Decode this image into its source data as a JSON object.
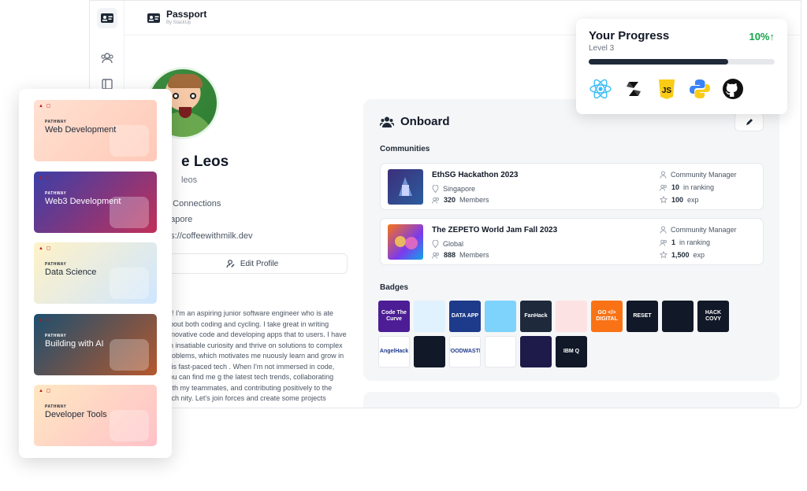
{
  "app": {
    "title": "Passport",
    "subtitle": "By StackUp"
  },
  "profile": {
    "name": "e Leos",
    "handle": "leos",
    "connections": "0 Connections",
    "location": "gapore",
    "website": "ps://coffeewithmilk.dev",
    "edit_label": "Edit Profile",
    "about_title": ":",
    "about_text": "re! I'm an aspiring junior software engineer who is ate about both coding and cycling. I take great in writing innovative code and developing apps that to users. I have an insatiable curiosity and thrive on solutions to complex problems, which motivates me nuously learn and grow in this fast-paced tech . When I'm not immersed in code, you can find me g the latest tech trends, collaborating with my teammates, and contributing positively to the tech nity. Let's join forces and create some projects"
  },
  "onboard": {
    "title": "Onboard",
    "communities_label": "Communities",
    "badges_label": "Badges",
    "communities": [
      {
        "name": "EthSG Hackathon 2023",
        "location": "Singapore",
        "members": "320",
        "members_label": "Members",
        "role": "Community Manager",
        "ranking": "10",
        "ranking_label": "in ranking",
        "exp": "100",
        "exp_label": "exp"
      },
      {
        "name": "The ZEPETO World Jam Fall 2023",
        "location": "Global",
        "members": "888",
        "members_label": "Members",
        "role": "Community Manager",
        "ranking": "1",
        "ranking_label": "in ranking",
        "exp": "1,500",
        "exp_label": "exp"
      }
    ],
    "badges": [
      {
        "text": "Code The Curve",
        "color": "#4c1d95"
      },
      {
        "text": "",
        "color": "#e0f2fe"
      },
      {
        "text": "DATA APP",
        "color": "#1e3a8a"
      },
      {
        "text": "",
        "color": "#7dd3fc"
      },
      {
        "text": "FanHack",
        "color": "#1e293b"
      },
      {
        "text": "",
        "color": "#fde2e4"
      },
      {
        "text": "GO </> DIGITAL",
        "color": "#f97316"
      },
      {
        "text": "RESET",
        "color": "#111827"
      },
      {
        "text": "",
        "color": "#111827"
      },
      {
        "text": "HACK COVY",
        "color": "#111827"
      },
      {
        "text": "AngelHack",
        "color": "#ffffff"
      },
      {
        "text": "",
        "color": "#111827"
      },
      {
        "text": "FOODWASTE",
        "color": "#ffffff"
      },
      {
        "text": "",
        "color": "#ffffff"
      },
      {
        "text": "",
        "color": "#1e1b4b"
      },
      {
        "text": "IBM Q",
        "color": "#111827"
      }
    ]
  },
  "progress": {
    "title": "Your Progress",
    "level": "Level 3",
    "percent_label": "10%↑",
    "bar_fraction": 0.75,
    "icons": [
      "react-icon",
      "solidity-icon",
      "javascript-icon",
      "python-icon",
      "github-icon"
    ]
  },
  "pathways": {
    "logo": "▲ ▢",
    "kicker": "PATHWAY",
    "items": [
      {
        "title": "Web Development",
        "bg": "linear-gradient(135deg,#ffe1d1,#ffc9b8)",
        "color": "#1f2937"
      },
      {
        "title": "Web3 Development",
        "bg": "linear-gradient(135deg,#3b3fa8,#c0305a)",
        "color": "#ffffff"
      },
      {
        "title": "Data Science",
        "bg": "linear-gradient(135deg,#fff2c7,#cfe6ff)",
        "color": "#1f2937"
      },
      {
        "title": "Building with AI",
        "bg": "linear-gradient(135deg,#1d4f6f,#b5582e)",
        "color": "#ffffff"
      },
      {
        "title": "Developer Tools",
        "bg": "linear-gradient(135deg,#ffe7c2,#ffc1c8)",
        "color": "#1f2937"
      }
    ]
  }
}
